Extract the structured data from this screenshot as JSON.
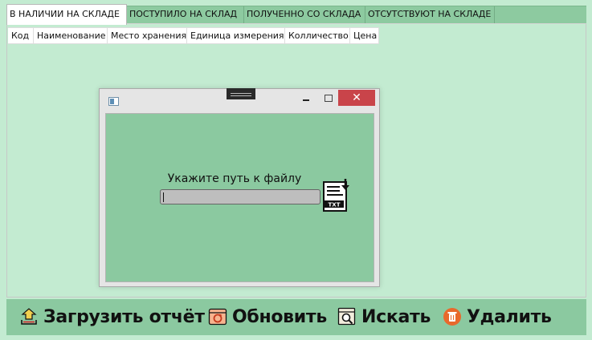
{
  "tabs": [
    {
      "label": "В НАЛИЧИИ НА СКЛАДЕ",
      "active": true
    },
    {
      "label": "ПОСТУПИЛО НА СКЛАД",
      "active": false
    },
    {
      "label": "ПОЛУЧЕННО СО СКЛАДА",
      "active": false
    },
    {
      "label": "ОТСУТСТВУЮТ НА СКЛАДЕ",
      "active": false
    }
  ],
  "grid": {
    "columns": [
      "Код",
      "Наименование",
      "Место хранения",
      "Единица измерения",
      "Колличество",
      "Цена"
    ]
  },
  "dialog": {
    "close_glyph": "✕",
    "prompt": "Укажите путь к файлу",
    "path_value": "",
    "file_icon_label": "TXT"
  },
  "toolbar": {
    "upload_label": "Загрузить отчёт",
    "refresh_label": "Обновить",
    "search_label": "Искать",
    "delete_label": "Удалить"
  },
  "colors": {
    "background": "#c3ebd1",
    "toolbar": "#8bc9a0",
    "tab_inactive": "#8dcaa0",
    "close_button": "#c9444a",
    "refresh_icon": "#e1734a",
    "delete_icon": "#e8692c"
  }
}
